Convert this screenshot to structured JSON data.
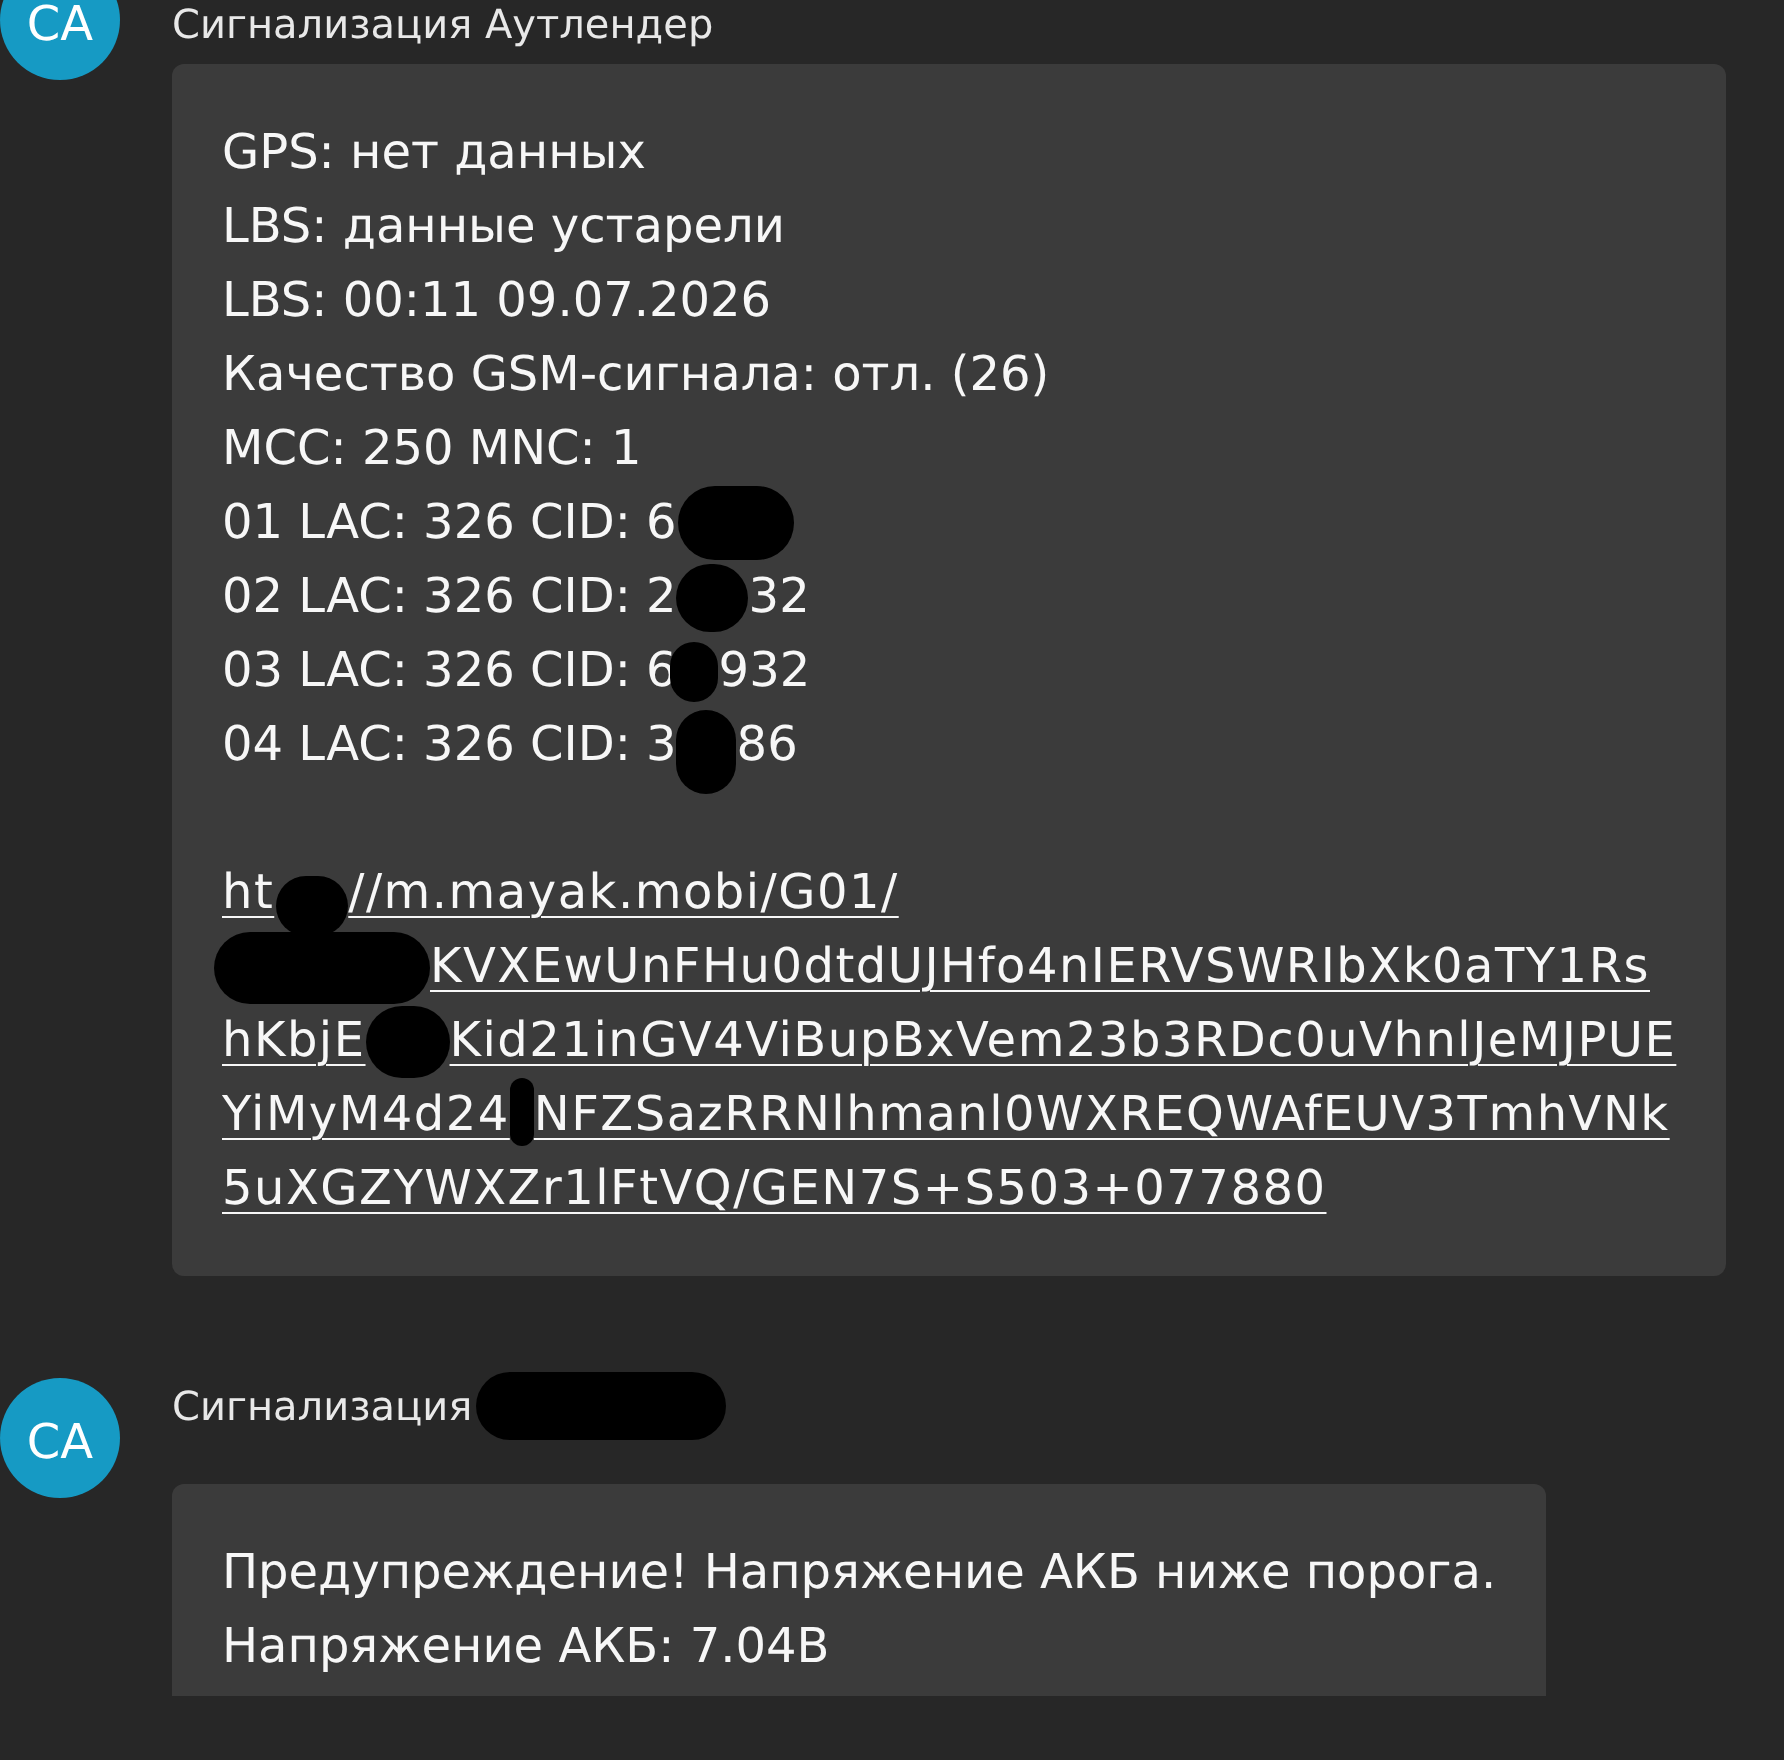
{
  "messages": [
    {
      "avatar": "СА",
      "sender": [
        {
          "kind": "text",
          "text": "Сигнализация Аутлендер"
        }
      ],
      "lines": [
        [
          {
            "kind": "text",
            "text": "GPS: нет данных"
          }
        ],
        [
          {
            "kind": "text",
            "text": "LBS: данные устарели"
          }
        ],
        [
          {
            "kind": "text",
            "text": "LBS: 00:11 09.07.2026"
          }
        ],
        [
          {
            "kind": "text",
            "text": "Качество GSM-сигнала: отл. (26)"
          }
        ],
        [
          {
            "kind": "text",
            "text": "MCC: 250 MNC: 1"
          }
        ],
        [
          {
            "kind": "text",
            "text": "01 LAC: 326 CID: 6"
          },
          {
            "kind": "redaction"
          }
        ],
        [
          {
            "kind": "text",
            "text": "02 LAC: 326 CID: 2"
          },
          {
            "kind": "redaction"
          },
          {
            "kind": "text",
            "text": "32"
          }
        ],
        [
          {
            "kind": "text",
            "text": "03 LAC: 326 CID: 6"
          },
          {
            "kind": "redaction"
          },
          {
            "kind": "text",
            "text": "932"
          }
        ],
        [
          {
            "kind": "text",
            "text": "04 LAC: 326 CID: 3"
          },
          {
            "kind": "redaction"
          },
          {
            "kind": "text",
            "text": "86"
          }
        ]
      ],
      "link_lines": [
        [
          {
            "kind": "text",
            "text": "ht"
          },
          {
            "kind": "redaction"
          },
          {
            "kind": "text",
            "text": "//m.mayak.mobi/G01/"
          }
        ],
        [
          {
            "kind": "redaction"
          },
          {
            "kind": "text",
            "text": "KVXEwUnFHu0dtdUJHfo4nIERVSWRIbXk0aTY1Rs"
          }
        ],
        [
          {
            "kind": "text",
            "text": "hKbjE"
          },
          {
            "kind": "redaction"
          },
          {
            "kind": "text",
            "text": "Kid21inGV4ViBupBxVem23b3RDc0uVhnlJeMJPUE"
          }
        ],
        [
          {
            "kind": "text",
            "text": "YiMyM4d24"
          },
          {
            "kind": "redaction"
          },
          {
            "kind": "text",
            "text": "NFZSazRRNlhmanl0WXREQWAfEUV3TmhVNk"
          }
        ],
        [
          {
            "kind": "text",
            "text": "5uXGZYWXZr1lFtVQ/GEN7S+S503+077880"
          }
        ]
      ]
    },
    {
      "avatar": "СА",
      "sender": [
        {
          "kind": "text",
          "text": "Сигнализация"
        },
        {
          "kind": "redaction"
        }
      ],
      "lines": [
        [
          {
            "kind": "text",
            "text": "Предупреждение! Напряжение АКБ ниже порога."
          }
        ],
        [
          {
            "kind": "text",
            "text": "Напряжение АКБ: 7.04В"
          }
        ]
      ]
    }
  ]
}
